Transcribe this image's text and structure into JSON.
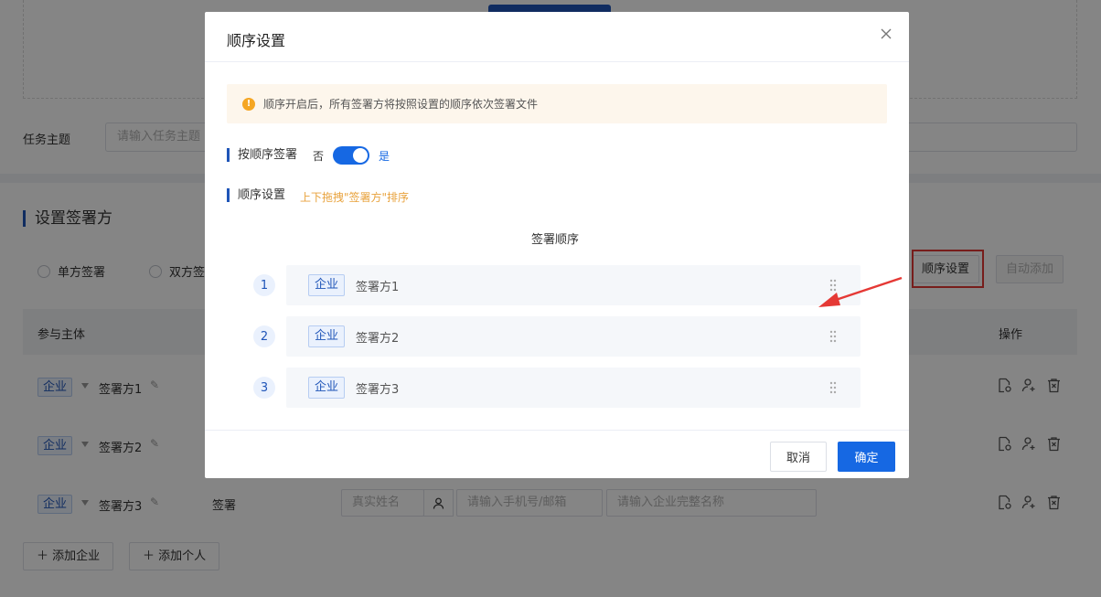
{
  "background": {
    "task_label": "任务主题",
    "task_placeholder": "请输入任务主题",
    "section_title": "设置签署方",
    "radio_single": "单方签署",
    "radio_double": "双方签",
    "btn_order_settings": "顺序设置",
    "btn_auto_add": "自动添加",
    "col_subject": "参与主体",
    "col_actions": "操作",
    "rows": [
      {
        "tag": "企业",
        "name": "签署方1"
      },
      {
        "tag": "企业",
        "name": "签署方2"
      },
      {
        "tag": "企业",
        "name": "签署方3",
        "sign_label": "签署"
      }
    ],
    "name_placeholder": "真实姓名",
    "phone_placeholder": "请输入手机号/邮箱",
    "company_placeholder": "请输入企业完整名称",
    "add_company": "添加企业",
    "add_person": "添加个人"
  },
  "dialog": {
    "title": "顺序设置",
    "notice": "顺序开启后，所有签署方将按照设置的顺序依次签署文件",
    "sequential_label": "按顺序签署",
    "toggle_off": "否",
    "toggle_on": "是",
    "order_label": "顺序设置",
    "order_hint": "上下拖拽\"签署方\"排序",
    "order_header": "签署顺序",
    "items": [
      {
        "index": "1",
        "tag": "企业",
        "name": "签署方1"
      },
      {
        "index": "2",
        "tag": "企业",
        "name": "签署方2"
      },
      {
        "index": "3",
        "tag": "企业",
        "name": "签署方3"
      }
    ],
    "cancel": "取消",
    "confirm": "确定"
  },
  "colors": {
    "primary": "#1668e3",
    "accent_bar": "#1f55b8",
    "warning": "#f5a623",
    "highlight_frame": "#e53935"
  },
  "icons": [
    "close-icon",
    "warning-icon",
    "drag-handle-icon",
    "edit-icon",
    "file-settings-icon",
    "add-user-icon",
    "delete-icon",
    "user-icon",
    "plus-icon",
    "arrow-annotation-icon"
  ]
}
